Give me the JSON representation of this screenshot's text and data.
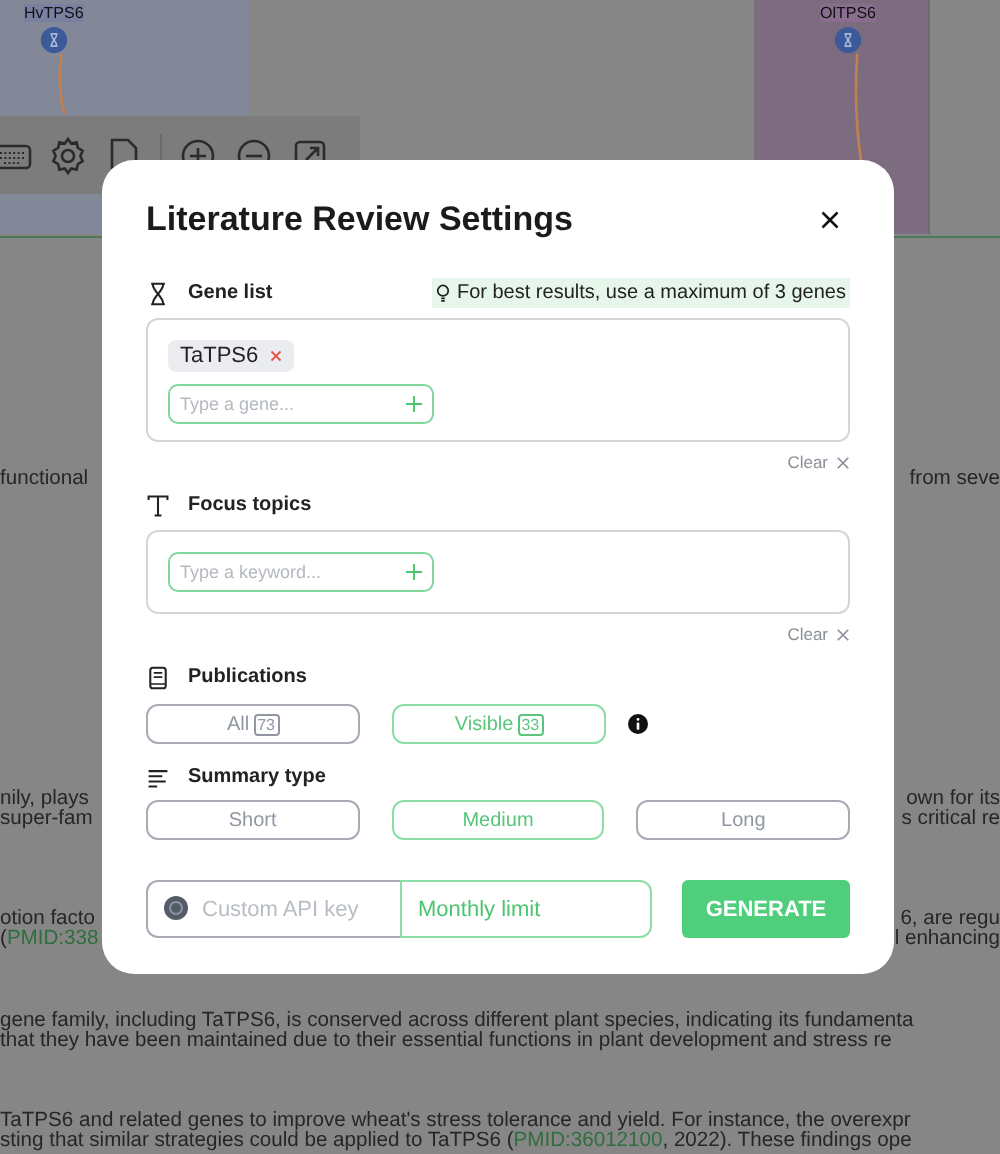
{
  "graph": {
    "nodes": [
      {
        "label": "HvTPS6"
      },
      {
        "label": "OlTPS6"
      }
    ]
  },
  "background_text": [
    {
      "left": [
        {
          "text": "functional",
          "kind": "plain"
        }
      ],
      "right": [
        {
          "text": "from seve",
          "kind": "plain"
        }
      ]
    },
    {
      "left": [
        {
          "text": "nily, plays",
          "kind": "plain"
        }
      ],
      "right": [
        {
          "text": "own for its",
          "kind": "plain"
        }
      ]
    },
    {
      "left": [
        {
          "text": "super-fam",
          "kind": "plain"
        }
      ],
      "right": [
        {
          "text": "s critical re",
          "kind": "plain"
        }
      ]
    },
    {
      "left": [
        {
          "text": "otion facto",
          "kind": "plain"
        }
      ],
      "right": [
        {
          "text": "6, are regu",
          "kind": "plain"
        }
      ]
    },
    {
      "left": [
        {
          "text": "(",
          "kind": "plain"
        },
        {
          "text": "PMID:338",
          "kind": "link"
        }
      ],
      "right": [
        {
          "text": "l enhancing",
          "kind": "plain"
        }
      ]
    },
    {
      "left": [
        {
          "text": "gene family, including TaTPS6, is conserved across different plant species, indicating its fundamenta",
          "kind": "plain"
        }
      ]
    },
    {
      "left": [
        {
          "text": "that they have been maintained due to their essential functions in plant development and stress re",
          "kind": "plain"
        }
      ]
    },
    {
      "left": [
        {
          "text": "TaTPS6 and related genes to improve wheat's stress tolerance and yield. For instance, the overexpr",
          "kind": "plain"
        }
      ]
    },
    {
      "left": [
        {
          "text": "sting that similar strategies could be applied to TaTPS6 (",
          "kind": "plain"
        },
        {
          "text": "PMID:36012100",
          "kind": "link"
        },
        {
          "text": ", 2022). These findings ope",
          "kind": "plain"
        }
      ]
    }
  ],
  "dialog": {
    "title": "Literature Review Settings",
    "gene_list": {
      "label": "Gene list",
      "tip": "For best results, use a maximum of 3 genes",
      "tags": [
        {
          "text": "TaTPS6"
        }
      ],
      "input": {
        "placeholder": "Type a gene..."
      },
      "clear": "Clear"
    },
    "focus_topics": {
      "label": "Focus topics",
      "input": {
        "placeholder": "Type a keyword..."
      },
      "clear": "Clear"
    },
    "publications": {
      "label": "Publications",
      "options": [
        {
          "label": "All",
          "count": "73",
          "selected": false
        },
        {
          "label": "Visible",
          "count": "33",
          "selected": true
        }
      ]
    },
    "summary_type": {
      "label": "Summary type",
      "options": [
        {
          "label": "Short",
          "selected": false
        },
        {
          "label": "Medium",
          "selected": true
        },
        {
          "label": "Long",
          "selected": false
        }
      ]
    },
    "api_key": {
      "placeholder": "Custom API key"
    },
    "monthly_limit": {
      "label": "Monthly limit"
    },
    "generate": "GENERATE"
  }
}
